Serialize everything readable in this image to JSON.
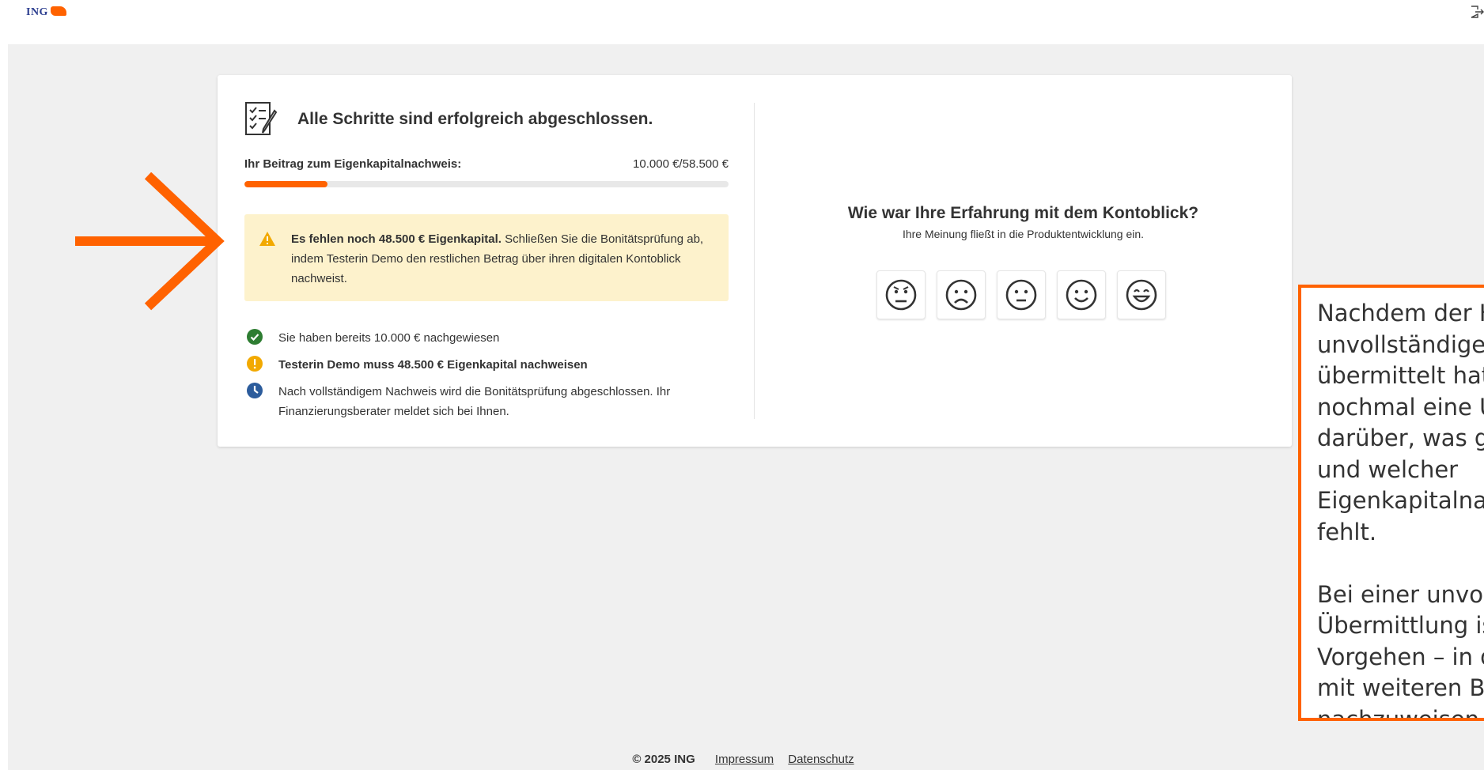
{
  "header": {
    "logo_text": "ING",
    "logo_icon": "ing-lion-icon",
    "logout_icon": "logout-icon"
  },
  "status": {
    "icon": "checklist-icon",
    "title": "Alle Schritte sind erfolgreich abgeschlossen.",
    "contribution_label": "Ihr Beitrag zum Eigenkapitalnachweis:",
    "contribution_value": "10.000 €/58.500 €",
    "progress_fraction": 0.171,
    "progress_color": "#ff6200"
  },
  "alert": {
    "icon": "warning-icon",
    "bold_text": "Es fehlen noch 48.500 € Eigenkapital.",
    "text": " Schließen Sie die Bonitätsprüfung ab, indem Testerin Demo den restlichen Betrag über ihren digitalen Kontoblick nachweist."
  },
  "checklist": [
    {
      "icon": "check-circle-icon",
      "text": "Sie haben bereits 10.000 € nachgewiesen"
    },
    {
      "icon": "exclamation-circle-icon",
      "text": "Testerin Demo muss 48.500 € Eigenkapital nachweisen"
    },
    {
      "icon": "clock-icon",
      "text": "Nach vollständigem Nachweis wird die Bonitätsprüfung abgeschlossen. Ihr Finanzierungsberater meldet sich bei Ihnen."
    }
  ],
  "feedback": {
    "title": "Wie war Ihre Erfahrung mit dem Kontoblick?",
    "subtitle": "Ihre Meinung fließt in die Produktentwicklung ein.",
    "faces": [
      "very-dissatisfied-face-icon",
      "dissatisfied-face-icon",
      "neutral-face-icon",
      "satisfied-face-icon",
      "very-satisfied-face-icon"
    ]
  },
  "annotation": {
    "arrow_icon": "orange-arrow-icon",
    "note_text": "Nachdem der Kunde eine unvollständige Übermittlung übermittelt hat, sieht er nochmal eine Übersicht darüber, was gefehlt hat und welcher Eigenkapitalnachweis noch fehlt.\n\nBei einer unvollständigen Übermittlung ist das Vorgehen – in diesem Fall mit weiteren Belegen nachzuweisen.",
    "accent_color": "#ff6200"
  },
  "footer": {
    "copyright": "© 2025 ING",
    "links": [
      "Impressum",
      "Datenschutz"
    ]
  }
}
